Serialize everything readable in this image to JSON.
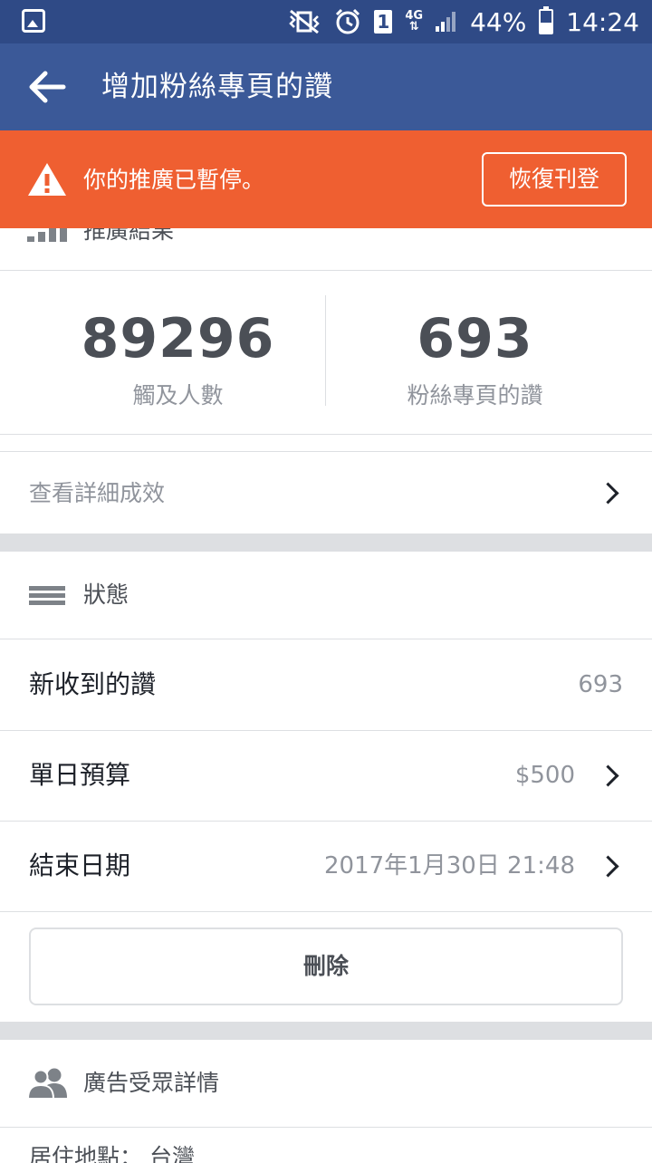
{
  "status_bar": {
    "sim_slot": "1",
    "network": "4G",
    "battery_percent": "44%",
    "battery_level": 0.44,
    "time": "14:24",
    "icons": [
      "gallery-icon",
      "vibrate-mute-icon",
      "alarm-icon",
      "sim-icon",
      "signal-icon",
      "battery-icon"
    ]
  },
  "appbar": {
    "back_icon": "arrow-left-icon",
    "title": "增加粉絲專頁的讚"
  },
  "alert": {
    "icon": "warning-icon",
    "message": "你的推廣已暫停。",
    "resume_label": "恢復刊登"
  },
  "results": {
    "title": "推廣結果",
    "icon": "bar-chart-icon"
  },
  "stats": [
    {
      "value": "89296",
      "label": "觸及人數"
    },
    {
      "value": "693",
      "label": "粉絲專頁的讚"
    }
  ],
  "details_link": "查看詳細成效",
  "status_section": {
    "title": "狀態",
    "icon": "list-icon",
    "rows": [
      {
        "label": "新收到的讚",
        "value": "693",
        "has_chevron": false
      },
      {
        "label": "單日預算",
        "value": "$500",
        "has_chevron": true
      },
      {
        "label": "結束日期",
        "value": "2017年1月30日 21:48",
        "has_chevron": true
      }
    ],
    "delete_label": "刪除"
  },
  "audience_section": {
    "title": "廣告受眾詳情",
    "icon": "people-icon",
    "location_text": "居住地點： 台灣"
  },
  "colors": {
    "status_bar": "#2f4a86",
    "appbar": "#3b5998",
    "alert": "#ef5f31",
    "separator": "#dddfe2",
    "muted_text": "#90949c"
  }
}
